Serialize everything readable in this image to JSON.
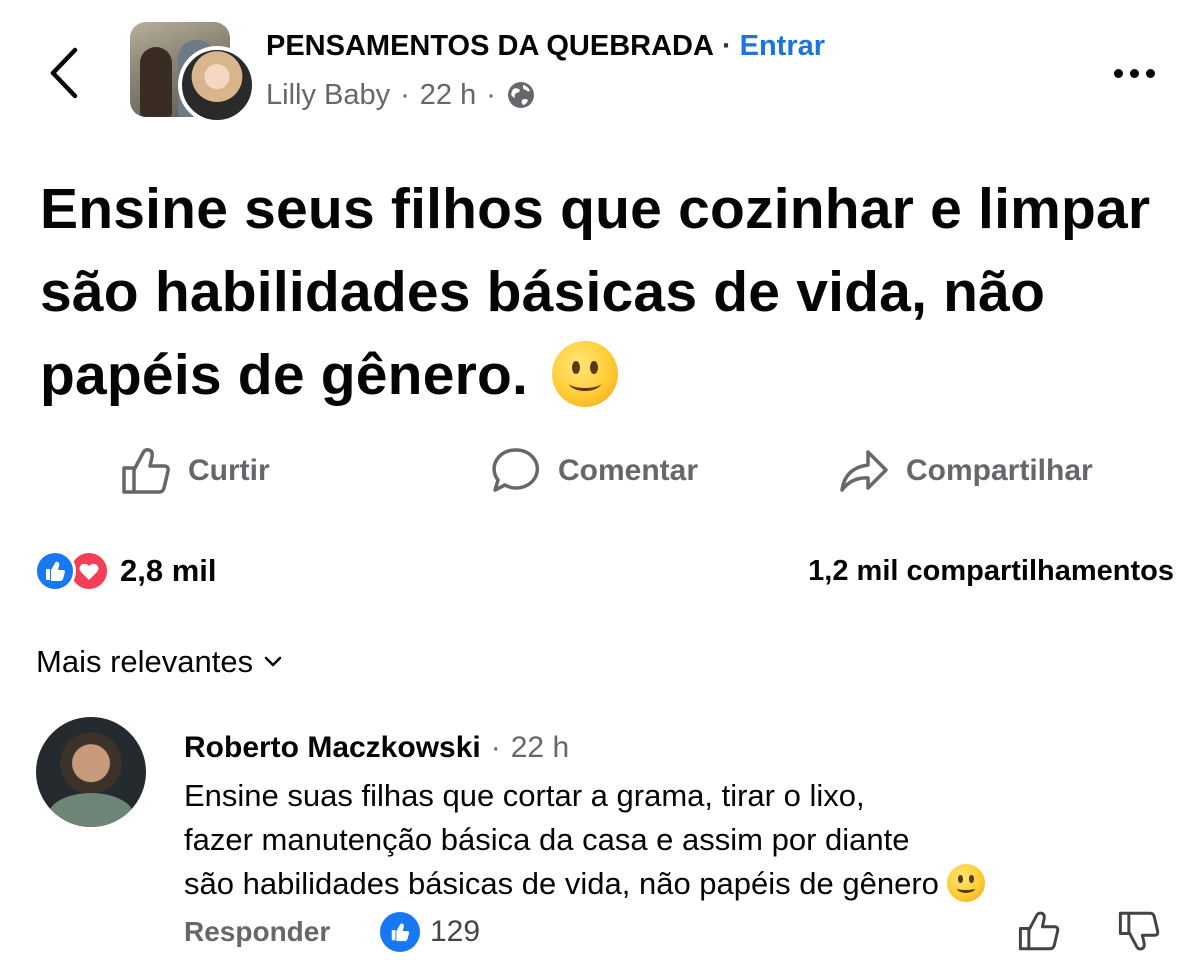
{
  "header": {
    "group_name": "PENSAMENTOS DA QUEBRADA",
    "separator": "·",
    "join_label": "Entrar",
    "author": "Lilly Baby",
    "time": "22 h",
    "privacy_icon": "globe-icon",
    "accent_color": "#1b74e4"
  },
  "post": {
    "text": "Ensine seus filhos que cozinhar e limpar são habilidades básicas de vida, não papéis de gênero.",
    "emoji": "slightly-smiling-face"
  },
  "actions": {
    "like_label": "Curtir",
    "comment_label": "Comentar",
    "share_label": "Compartilhar"
  },
  "stats": {
    "reactions_count": "2,8 mil",
    "reaction_types": [
      "like",
      "love"
    ],
    "shares": "1,2 mil compartilhamentos"
  },
  "sort": {
    "label": "Mais relevantes"
  },
  "comment": {
    "author": "Roberto Maczkowski",
    "time": "22 h",
    "lines": [
      "Ensine suas filhas que cortar a grama, tirar o lixo,",
      "fazer manutenção básica da casa e assim por diante",
      "são habilidades básicas de vida, não papéis de gênero"
    ],
    "reply_label": "Responder",
    "likes": "129"
  }
}
